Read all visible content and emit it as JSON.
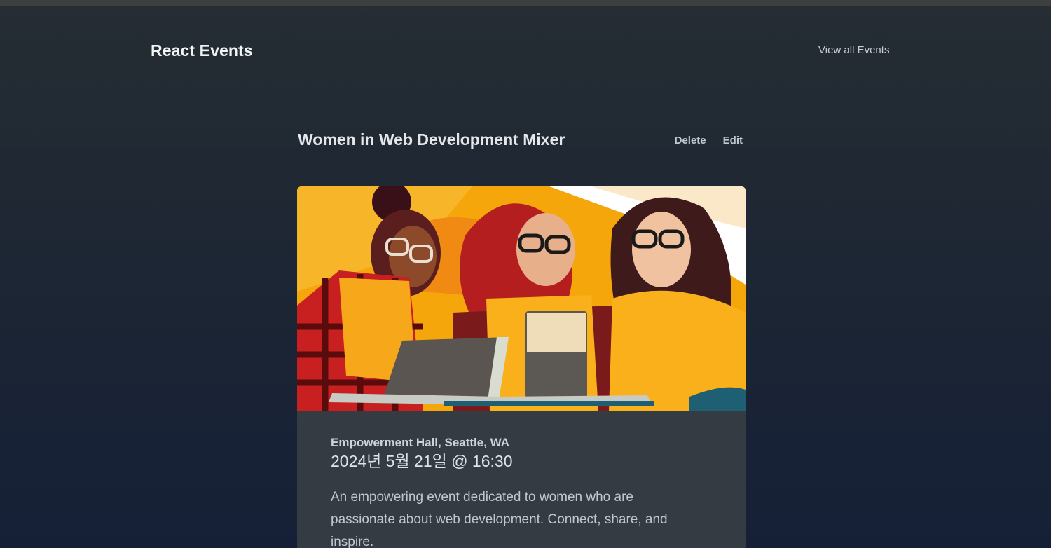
{
  "header": {
    "brand": "React Events",
    "nav_link": "View all Events"
  },
  "event": {
    "title": "Women in Web Development Mixer",
    "actions": {
      "delete_label": "Delete",
      "edit_label": "Edit"
    },
    "image_alt": "Women in Web Development Mixer",
    "location": "Empowerment Hall, Seattle, WA",
    "datetime": "2024년 5월 21일 @ 16:30",
    "description": "An empowering event dedicated to women who are passionate about web development. Connect, share, and inspire."
  },
  "colors": {
    "background_top": "#262d33",
    "background_bottom": "#152037",
    "card": "#343b43",
    "illustration_orange": "#f5a60a",
    "illustration_red": "#b02020"
  }
}
